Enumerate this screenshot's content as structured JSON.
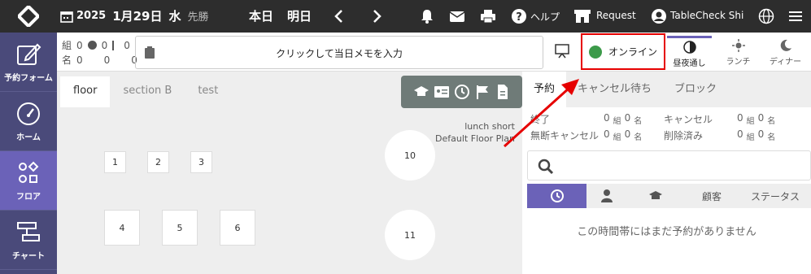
{
  "header": {
    "year": "2025",
    "month_day": "1月29日",
    "weekday": "水",
    "rokuyo": "先勝",
    "today_label": "本日",
    "tomorrow_label": "明日",
    "help_label": "ヘルプ",
    "request_label": "Request",
    "account_label": "TableCheck Shi"
  },
  "sidebar": {
    "items": [
      {
        "label": "予約フォーム",
        "icon": "edit-icon"
      },
      {
        "label": "ホーム",
        "icon": "gauge-icon"
      },
      {
        "label": "フロア",
        "icon": "shapes-icon"
      },
      {
        "label": "チャート",
        "icon": "chart-icon"
      }
    ]
  },
  "statusbar": {
    "counts_row1": [
      "組",
      "0",
      "0",
      "0"
    ],
    "counts_row2": [
      "名",
      "0",
      "0",
      "0"
    ],
    "memo_placeholder": "クリックして当日メモを入力",
    "online_label": "オンライン",
    "modes": [
      "昼夜通し",
      "ランチ",
      "ディナー"
    ]
  },
  "floor": {
    "tabs": [
      "floor",
      "section B",
      "test"
    ],
    "plan_line1": "lunch short",
    "plan_line2": "Default Floor Plan",
    "tables": [
      "1",
      "2",
      "3",
      "4",
      "5",
      "6",
      "10",
      "11"
    ]
  },
  "reservations": {
    "tabs": [
      "予約",
      "キャンセル待ち",
      "ブロック"
    ],
    "stats": [
      {
        "label": "終了",
        "groups": "0",
        "people": "0"
      },
      {
        "label": "キャンセル",
        "groups": "0",
        "people": "0"
      },
      {
        "label": "無断キャンセル",
        "groups": "0",
        "people": "0"
      },
      {
        "label": "削除済み",
        "groups": "0",
        "people": "0"
      }
    ],
    "unit_groups": "組",
    "unit_people": "名",
    "columns": [
      "顧客",
      "ステータス"
    ],
    "empty_message": "この時間帯にはまだ予約がありません"
  },
  "colors": {
    "topbar": "#2d2d2d",
    "sidebar": "#4a4a7a",
    "accent": "#6b62b8",
    "highlight": "#e60000",
    "online": "#3c9a4a"
  }
}
